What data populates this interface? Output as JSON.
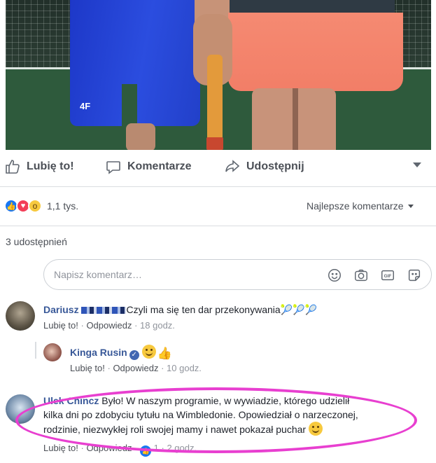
{
  "post": {
    "image_alt": "",
    "shorts_logo": "4F"
  },
  "actions": {
    "like": "Lubię to!",
    "comment": "Komentarze",
    "share": "Udostępnij"
  },
  "reactions": {
    "count": "1,1 tys.",
    "types": [
      "like-icon",
      "love-icon",
      "wow-icon"
    ],
    "sort_label": "Najlepsze komentarze"
  },
  "shares": "3 udostępnień",
  "composer": {
    "placeholder": "Napisz komentarz…",
    "icons": [
      "emoji-icon",
      "camera-icon",
      "gif-icon",
      "sticker-icon"
    ]
  },
  "comments": [
    {
      "author": "Dariusz",
      "text": "Czyli ma się ten dar przekonywania",
      "like": "Lubię to!",
      "reply": "Odpowiedz",
      "time": "18 godz."
    },
    {
      "author": "Kinga Rusin",
      "like": "Lubię to!",
      "reply": "Odpowiedz",
      "time": "10 godz."
    },
    {
      "author": "Ulek Chincz",
      "text_line1": "Było! W naszym programie, w wywiadzie, którego udzielił",
      "text_line2": "kilka dni po zdobyciu tytułu na Wimbledonie. Opowiedział o narzeczonej,",
      "text_line3": "rodzinie, niezwykłej roli swojej mamy i nawet pokazał puchar",
      "like": "Lubię to!",
      "reply": "Odpowiedz",
      "like_count": "1",
      "time": "2 godz."
    }
  ],
  "colors": {
    "link": "#385898",
    "highlight": "#e83fd0",
    "like_blue": "#1877f2"
  }
}
